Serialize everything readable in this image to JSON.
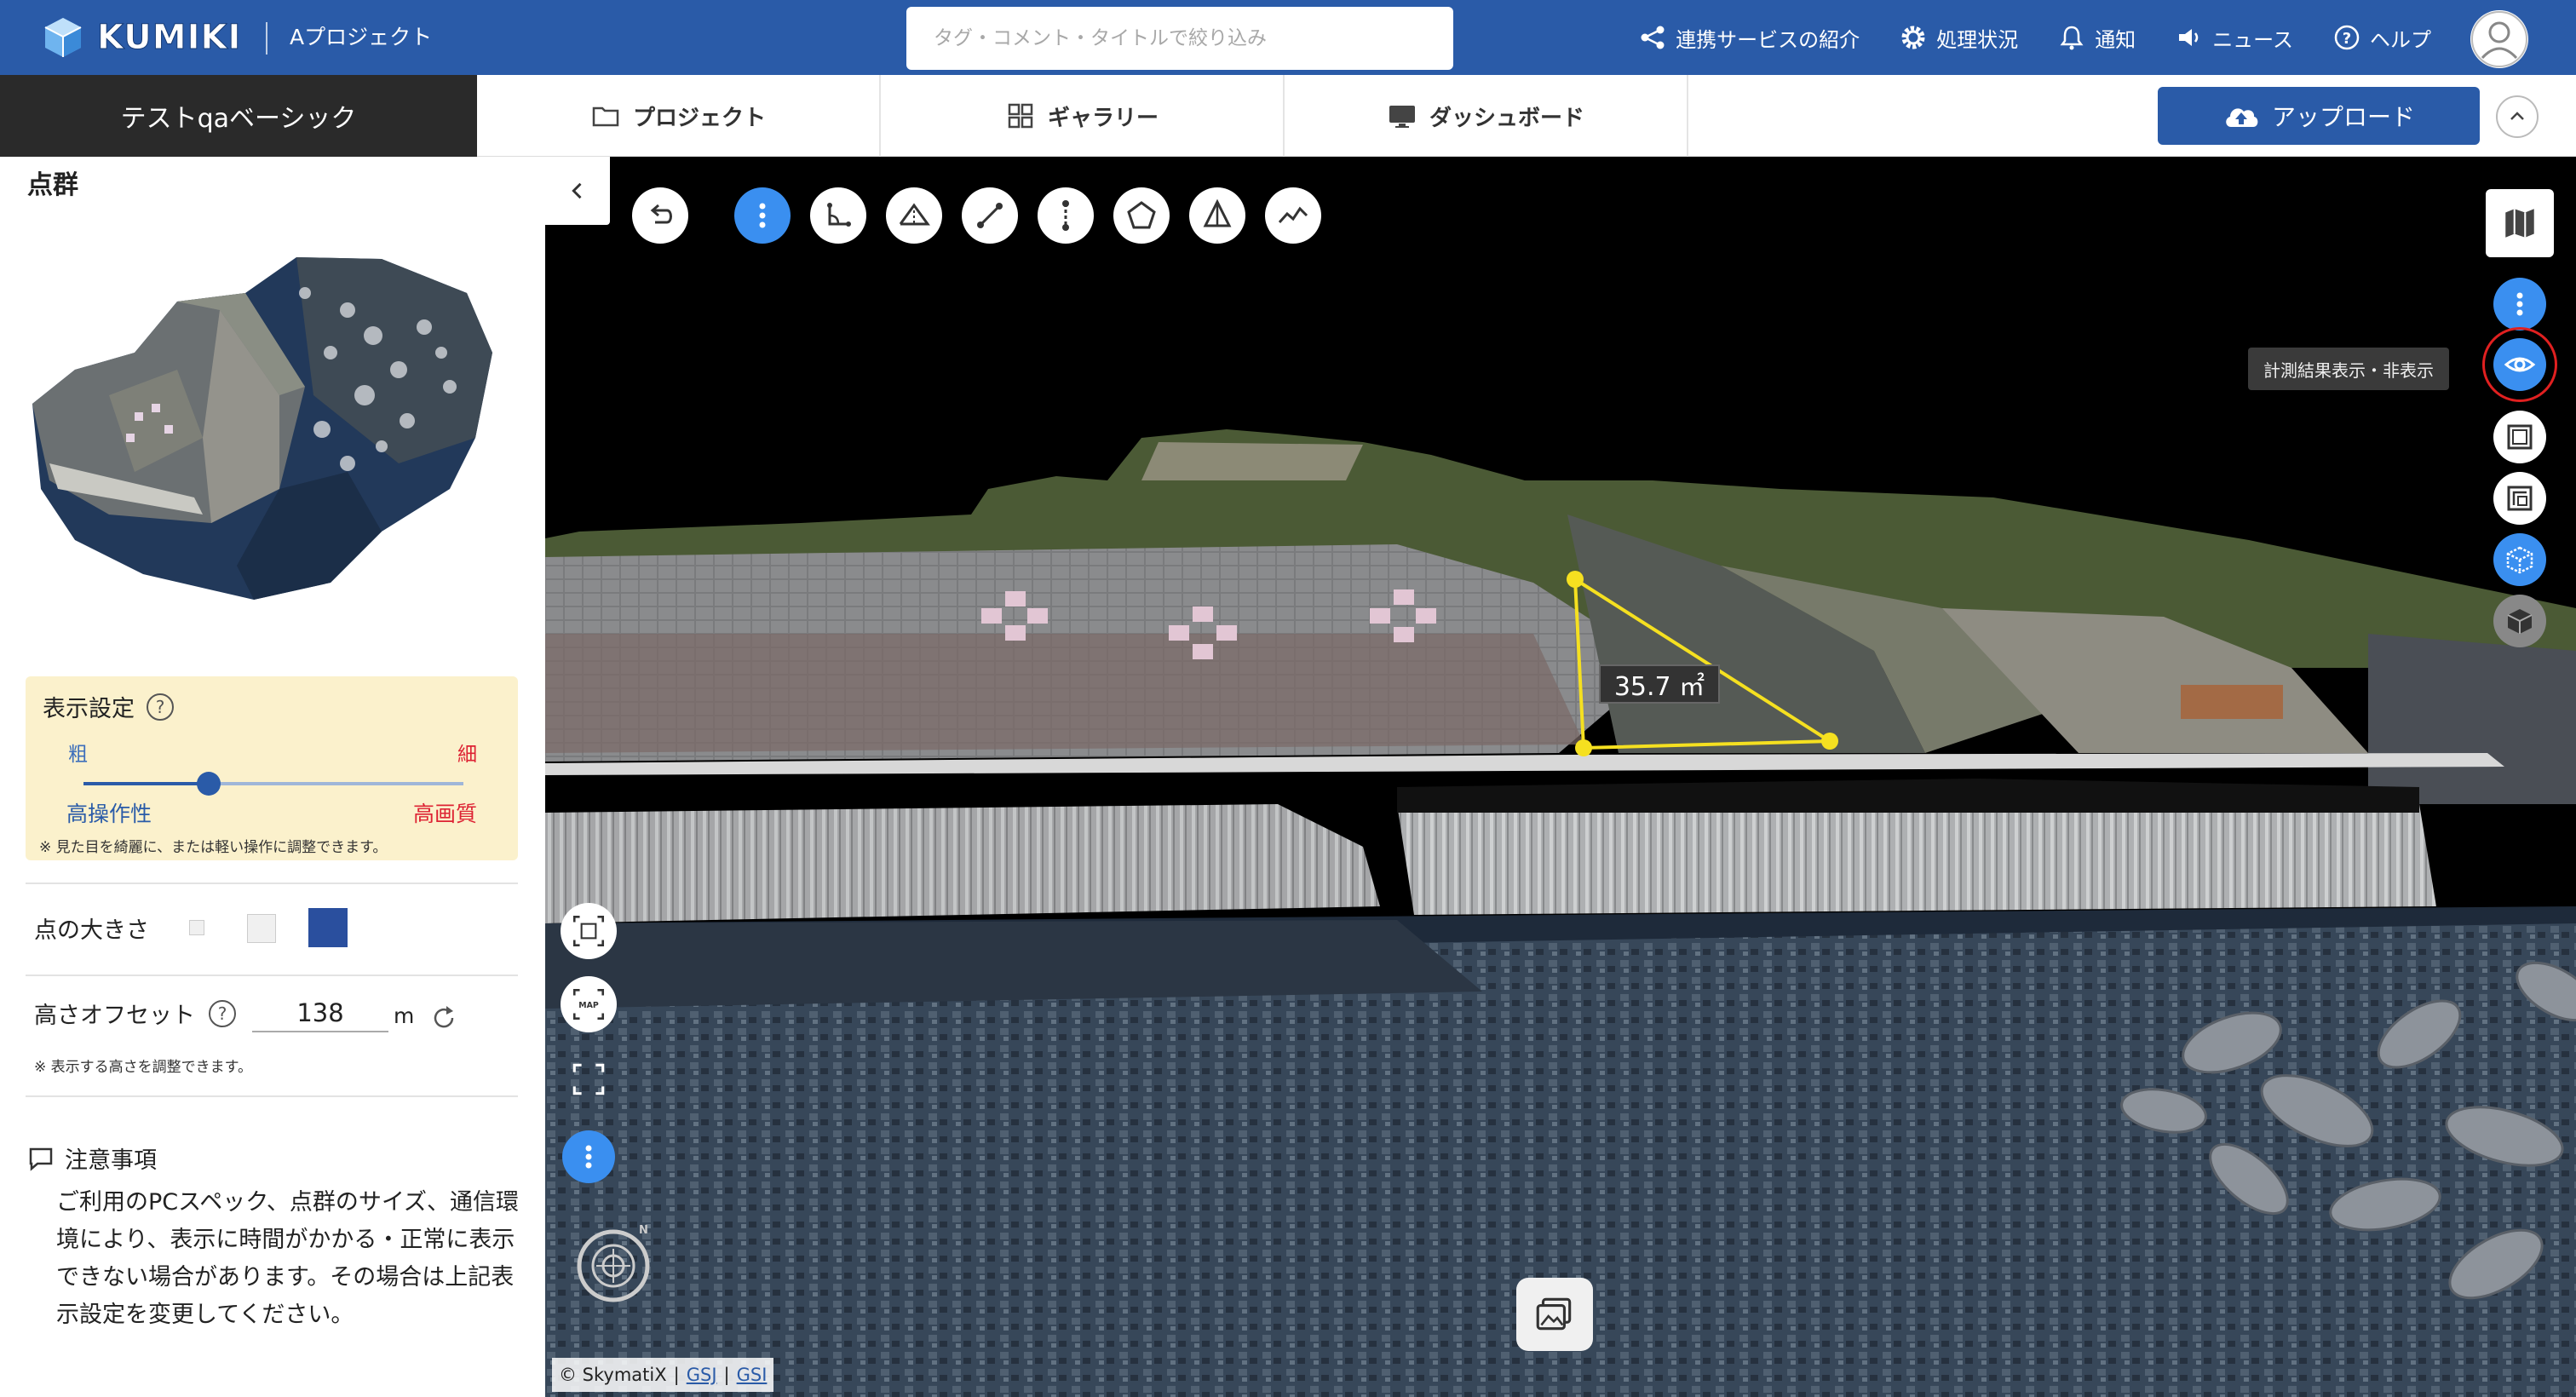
{
  "app": {
    "logo_text": "KUMIKI",
    "project_name": "Aプロジェクト"
  },
  "header": {
    "search_placeholder": "タグ・コメント・タイトルで絞り込み",
    "nav": [
      {
        "label": "連携サービスの紹介",
        "icon": "share-icon"
      },
      {
        "label": "処理状況",
        "icon": "gear-icon"
      },
      {
        "label": "通知",
        "icon": "bell-icon"
      },
      {
        "label": "ニュース",
        "icon": "megaphone-icon"
      },
      {
        "label": "ヘルプ",
        "icon": "help-icon"
      }
    ]
  },
  "subbar": {
    "current": "テストqaベーシック",
    "tabs": [
      {
        "label": "プロジェクト",
        "icon": "folder-icon"
      },
      {
        "label": "ギャラリー",
        "icon": "grid-icon"
      },
      {
        "label": "ダッシュボード",
        "icon": "monitor-icon"
      }
    ],
    "upload_label": "アップロード"
  },
  "sidebar": {
    "title": "点群",
    "display_settings": {
      "title": "表示設定",
      "coarse": "粗",
      "fine": "細",
      "performance": "高操作性",
      "quality": "高画質",
      "level": 0.33,
      "note": "※ 見た目を綺麗に、または軽い操作に調整できます。"
    },
    "point_size": {
      "label": "点の大きさ",
      "selected": "large",
      "accent": "#2a4f9e"
    },
    "height_offset": {
      "label": "高さオフセット",
      "value": "138",
      "unit": "m",
      "note": "※ 表示する高さを調整できます。"
    },
    "caution": {
      "title": "注意事項",
      "body": "ご利用のPCスペック、点群のサイズ、通信環境により、表示に時間がかかる・正常に表示できない場合があります。その場合は上記表示設定を変更してください。"
    }
  },
  "viewer": {
    "tooltip": "計測結果表示・非表示",
    "measurement": "35.7 ㎡",
    "attribution": {
      "prefix": "© SkymatiX",
      "link1": "GSJ",
      "link2": "GSI"
    },
    "compass_label": "N",
    "map_button_label": "MAP"
  },
  "colors": {
    "brand": "#2a5ba8",
    "active": "#3a8ff0",
    "measure": "#f5e020",
    "alert": "#e02020"
  }
}
